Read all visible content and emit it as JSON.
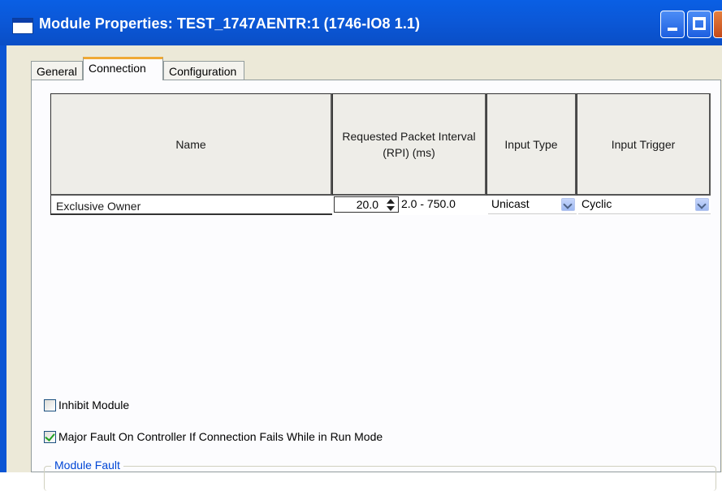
{
  "window": {
    "title": "Module Properties: TEST_1747AENTR:1 (1746-IO8 1.1)"
  },
  "tabs": [
    {
      "label": "General",
      "active": false
    },
    {
      "label": "Connection",
      "active": true
    },
    {
      "label": "Configuration",
      "active": false
    }
  ],
  "grid": {
    "headers": {
      "name": "Name",
      "rpi": "Requested Packet Interval (RPI) (ms)",
      "input_type": "Input Type",
      "input_trigger": "Input Trigger"
    },
    "rows": [
      {
        "name": "Exclusive Owner",
        "rpi_value": "20.0",
        "rpi_range": "2.0 - 750.0",
        "input_type": "Unicast",
        "input_trigger": "Cyclic"
      }
    ]
  },
  "options": {
    "inhibit_module": {
      "label": "Inhibit Module",
      "checked": false
    },
    "major_fault": {
      "label": "Major Fault On Controller If Connection Fails While in Run Mode",
      "checked": true
    }
  },
  "module_fault": {
    "title": "Module Fault"
  },
  "colors": {
    "titlebar": "#0b58d8",
    "dialog_bg": "#ece9d8",
    "active_tab_accent": "#f0a934",
    "group_title": "#0046d5",
    "check_mark": "#21a121"
  }
}
